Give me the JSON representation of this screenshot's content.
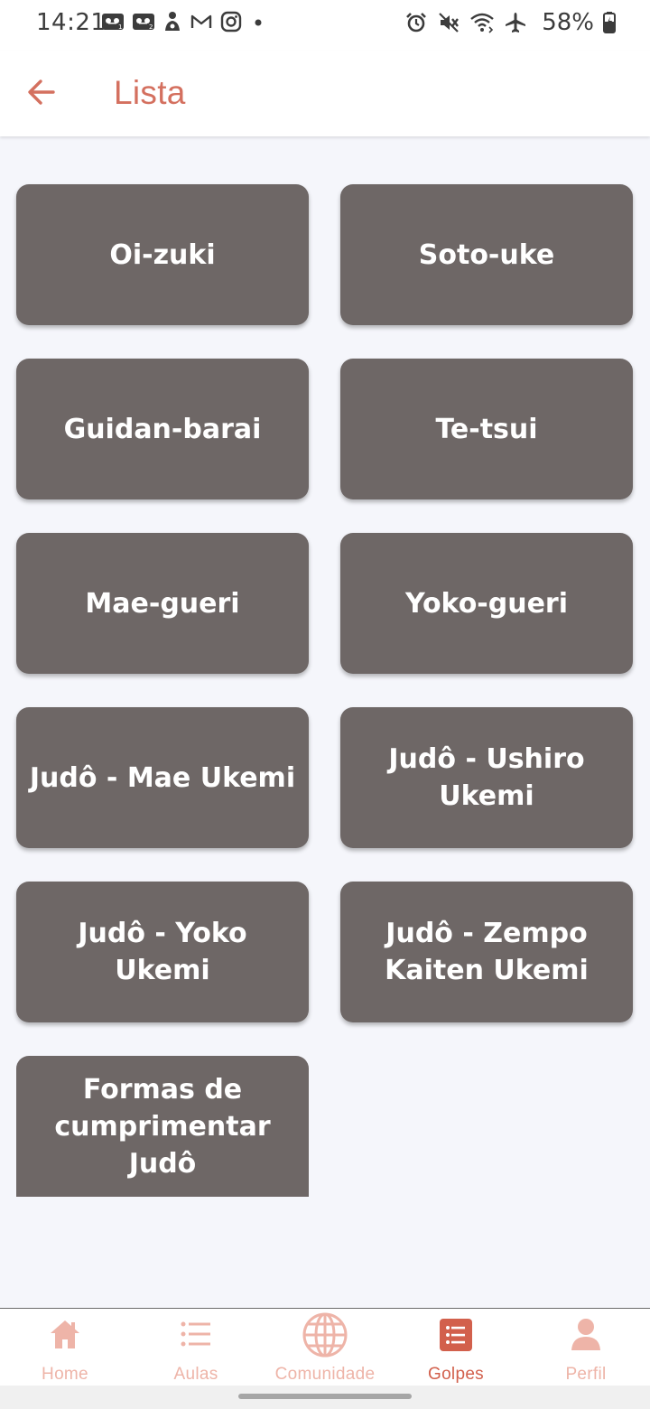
{
  "status_bar": {
    "time": "14:21",
    "battery": "58%",
    "left_icons": [
      "voicemail-icon",
      "voicemail-2-icon",
      "app-notification-icon",
      "gmail-icon",
      "instagram-icon",
      "dot-icon"
    ],
    "right_icons": [
      "alarm-icon",
      "mute-icon",
      "wifi-icon",
      "airplane-icon",
      "battery-charging-icon"
    ]
  },
  "app_bar": {
    "title": "Lista",
    "back_icon": "arrow-left-icon"
  },
  "moves": [
    {
      "label": "Oi-zuki"
    },
    {
      "label": "Soto-uke"
    },
    {
      "label": "Guidan-barai"
    },
    {
      "label": "Te-tsui"
    },
    {
      "label": "Mae-gueri"
    },
    {
      "label": "Yoko-gueri"
    },
    {
      "label": "Judô - Mae Ukemi"
    },
    {
      "label": "Judô - Ushiro Ukemi"
    },
    {
      "label": "Judô - Yoko Ukemi"
    },
    {
      "label": "Judô - Zempo Kaiten Ukemi"
    },
    {
      "label": "Formas de cumprimentar Judô"
    }
  ],
  "bottom_nav": {
    "items": [
      {
        "label": "Home",
        "icon": "home-icon",
        "active": false
      },
      {
        "label": "Aulas",
        "icon": "list-icon",
        "active": false
      },
      {
        "label": "Comunidade",
        "icon": "globe-icon",
        "active": false
      },
      {
        "label": "Golpes",
        "icon": "list-box-icon",
        "active": true
      },
      {
        "label": "Perfil",
        "icon": "person-icon",
        "active": false
      }
    ]
  },
  "colors": {
    "accent": "#d4705f",
    "card": "#6e6766",
    "nav_inactive": "#eeb4a8",
    "nav_active": "#d2604c",
    "background": "#f5f6fb"
  }
}
